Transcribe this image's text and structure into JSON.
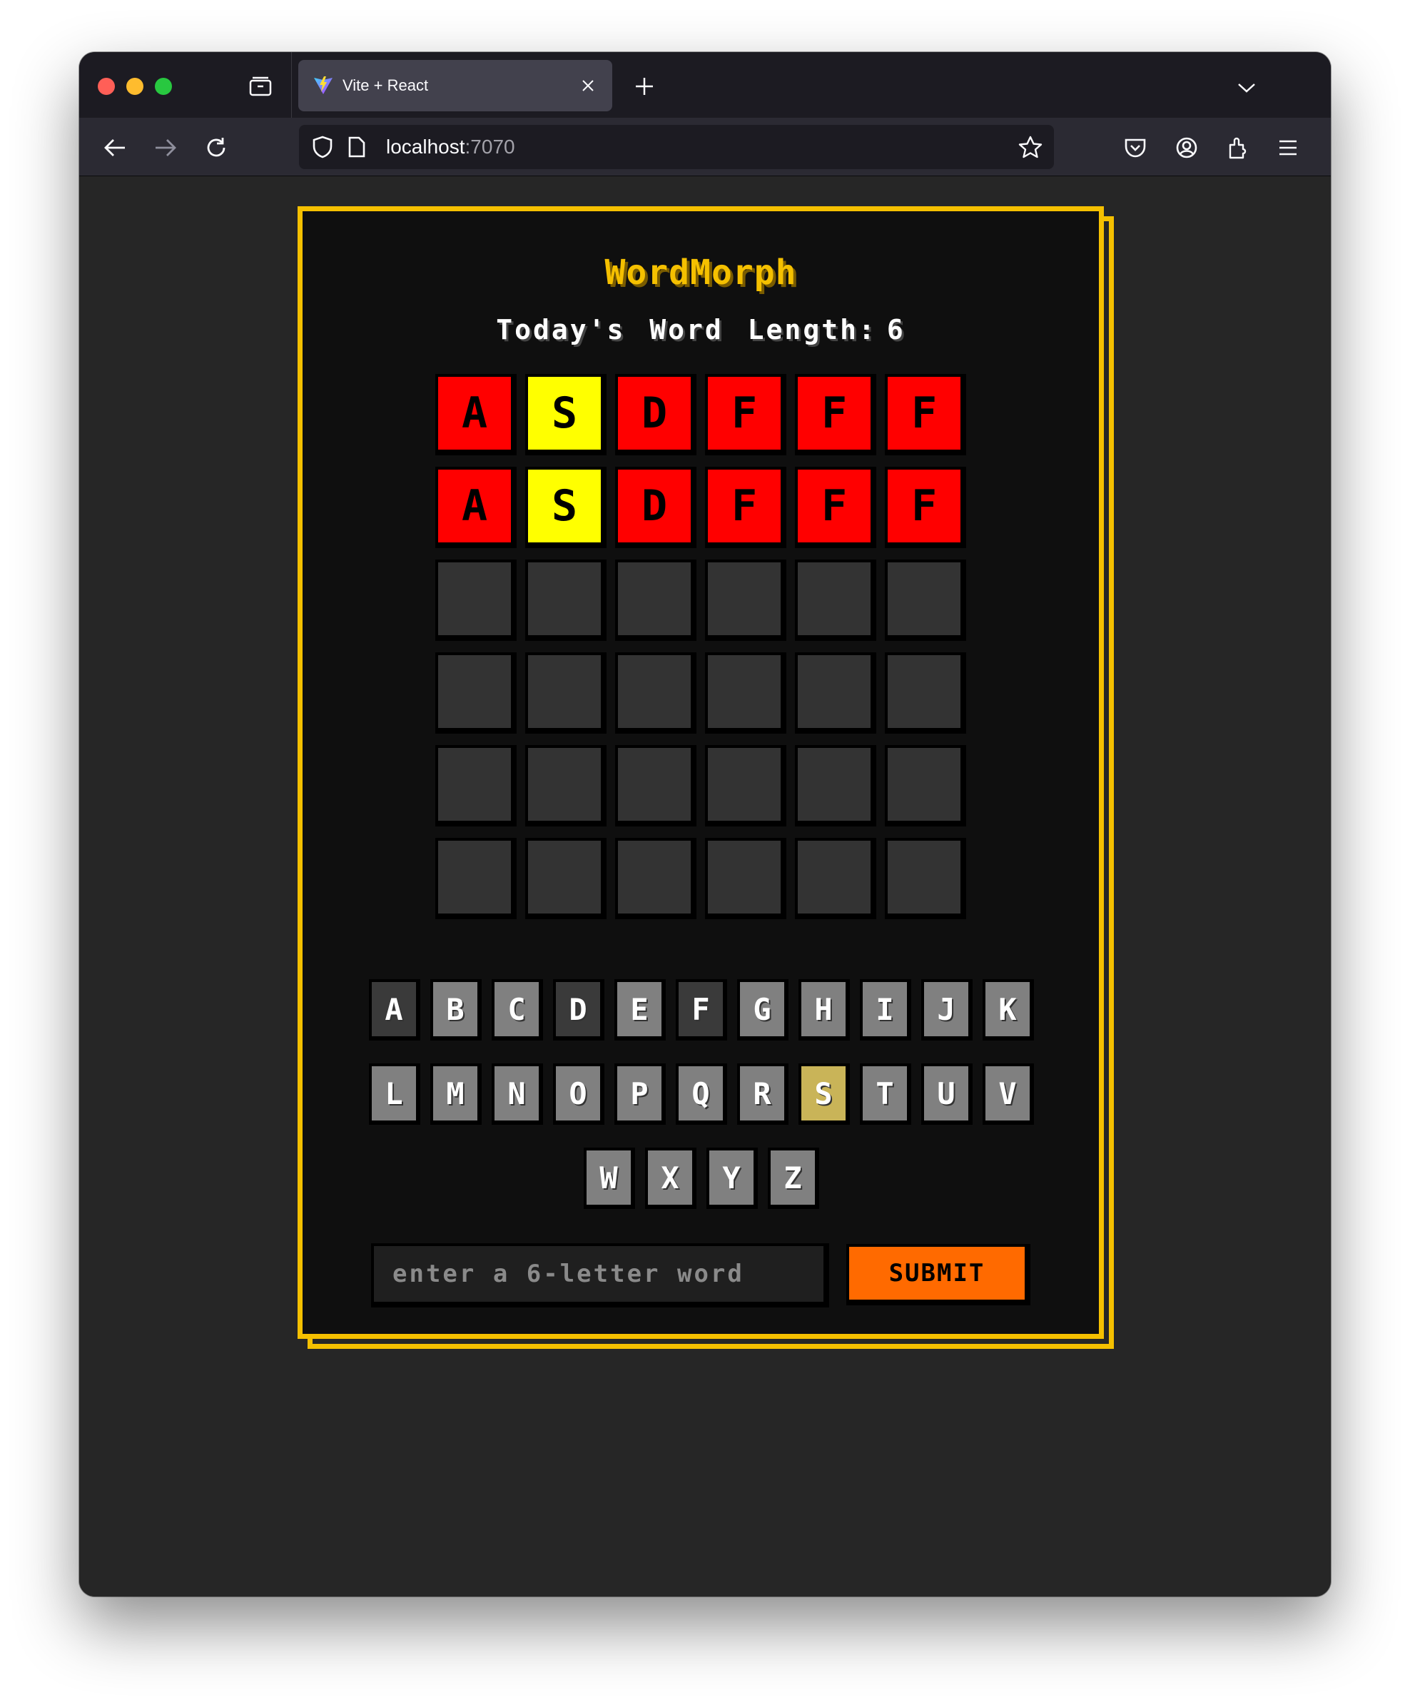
{
  "browser": {
    "tab_title": "Vite + React",
    "url_host": "localhost",
    "url_port": ":7070",
    "icons": [
      "tab-view-icon",
      "vite-logo-icon",
      "close-icon",
      "plus-icon",
      "chevron-down-icon",
      "back-arrow-icon",
      "forward-arrow-icon",
      "reload-icon",
      "shield-icon",
      "page-icon",
      "star-icon",
      "pocket-icon",
      "account-icon",
      "extensions-icon",
      "menu-icon"
    ]
  },
  "game": {
    "title": "WordMorph",
    "subtitle_label": "Today's Word Length:",
    "word_length": "6",
    "colors": {
      "absent": "#ff0000",
      "present": "#ffff00",
      "empty": "#333333",
      "accent": "#f5c000",
      "submit": "#ff6a00"
    },
    "grid": [
      [
        {
          "letter": "A",
          "state": "absent"
        },
        {
          "letter": "S",
          "state": "present"
        },
        {
          "letter": "D",
          "state": "absent"
        },
        {
          "letter": "F",
          "state": "absent"
        },
        {
          "letter": "F",
          "state": "absent"
        },
        {
          "letter": "F",
          "state": "absent"
        }
      ],
      [
        {
          "letter": "A",
          "state": "absent"
        },
        {
          "letter": "S",
          "state": "present"
        },
        {
          "letter": "D",
          "state": "absent"
        },
        {
          "letter": "F",
          "state": "absent"
        },
        {
          "letter": "F",
          "state": "absent"
        },
        {
          "letter": "F",
          "state": "absent"
        }
      ],
      [
        {
          "letter": "",
          "state": "empty"
        },
        {
          "letter": "",
          "state": "empty"
        },
        {
          "letter": "",
          "state": "empty"
        },
        {
          "letter": "",
          "state": "empty"
        },
        {
          "letter": "",
          "state": "empty"
        },
        {
          "letter": "",
          "state": "empty"
        }
      ],
      [
        {
          "letter": "",
          "state": "empty"
        },
        {
          "letter": "",
          "state": "empty"
        },
        {
          "letter": "",
          "state": "empty"
        },
        {
          "letter": "",
          "state": "empty"
        },
        {
          "letter": "",
          "state": "empty"
        },
        {
          "letter": "",
          "state": "empty"
        }
      ],
      [
        {
          "letter": "",
          "state": "empty"
        },
        {
          "letter": "",
          "state": "empty"
        },
        {
          "letter": "",
          "state": "empty"
        },
        {
          "letter": "",
          "state": "empty"
        },
        {
          "letter": "",
          "state": "empty"
        },
        {
          "letter": "",
          "state": "empty"
        }
      ],
      [
        {
          "letter": "",
          "state": "empty"
        },
        {
          "letter": "",
          "state": "empty"
        },
        {
          "letter": "",
          "state": "empty"
        },
        {
          "letter": "",
          "state": "empty"
        },
        {
          "letter": "",
          "state": "empty"
        },
        {
          "letter": "",
          "state": "empty"
        }
      ]
    ],
    "keyboard": [
      [
        {
          "k": "A",
          "s": "used"
        },
        {
          "k": "B",
          "s": "unused"
        },
        {
          "k": "C",
          "s": "unused"
        },
        {
          "k": "D",
          "s": "used"
        },
        {
          "k": "E",
          "s": "unused"
        },
        {
          "k": "F",
          "s": "used"
        },
        {
          "k": "G",
          "s": "unused"
        },
        {
          "k": "H",
          "s": "unused"
        },
        {
          "k": "I",
          "s": "unused"
        },
        {
          "k": "J",
          "s": "unused"
        },
        {
          "k": "K",
          "s": "unused"
        }
      ],
      [
        {
          "k": "L",
          "s": "unused"
        },
        {
          "k": "M",
          "s": "unused"
        },
        {
          "k": "N",
          "s": "unused"
        },
        {
          "k": "O",
          "s": "unused"
        },
        {
          "k": "P",
          "s": "unused"
        },
        {
          "k": "Q",
          "s": "unused"
        },
        {
          "k": "R",
          "s": "unused"
        },
        {
          "k": "S",
          "s": "present"
        },
        {
          "k": "T",
          "s": "unused"
        },
        {
          "k": "U",
          "s": "unused"
        },
        {
          "k": "V",
          "s": "unused"
        }
      ],
      [
        {
          "k": "W",
          "s": "unused"
        },
        {
          "k": "X",
          "s": "unused"
        },
        {
          "k": "Y",
          "s": "unused"
        },
        {
          "k": "Z",
          "s": "unused"
        }
      ]
    ],
    "input_placeholder": "enter a 6-letter word",
    "input_value": "",
    "submit_label": "SUBMIT"
  }
}
